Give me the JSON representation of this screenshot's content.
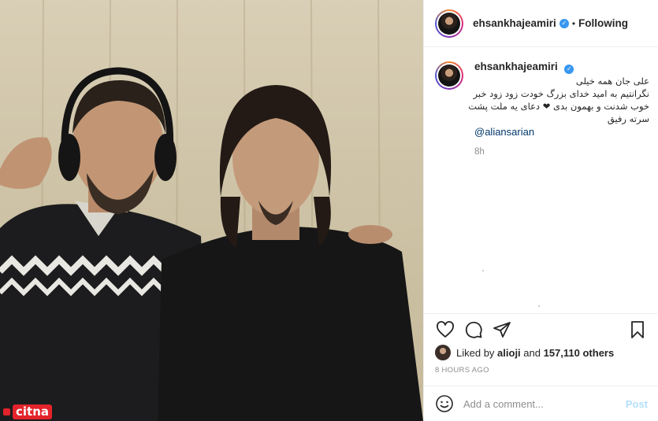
{
  "photo": {
    "alt": "",
    "watermark": "citna"
  },
  "header": {
    "username": "ehsankhajeamiri",
    "separator": "•",
    "follow_status": "Following"
  },
  "caption": {
    "username": "ehsankhajeamiri",
    "lines": [
      "علی جان همه خیلی",
      "نگرانتیم به امید خدای بزرگ خودت زود زود خبر",
      "خوب شدنت و بهمون بدی ❤ دعای یه ملت پشت",
      "سرته رفیق"
    ],
    "mention": "@aliansarian",
    "time": "8h"
  },
  "likes": {
    "prefix": "Liked by ",
    "first_user": "alioji",
    "middle": " and ",
    "count_text": "157,110 others"
  },
  "timestamp": "8 HOURS AGO",
  "comment_box": {
    "placeholder": "Add a comment...",
    "post_label": "Post"
  },
  "icons": {
    "verified": "verified-badge-icon",
    "like": "heart-icon",
    "comment": "speech-bubble-icon",
    "share": "paper-plane-icon",
    "save": "bookmark-icon",
    "emoji": "smiley-icon"
  },
  "colors": {
    "verified_blue": "#3897f0",
    "mention_blue": "#00376b",
    "post_disabled": "#b2dffc",
    "watermark_red": "#e3232b"
  }
}
